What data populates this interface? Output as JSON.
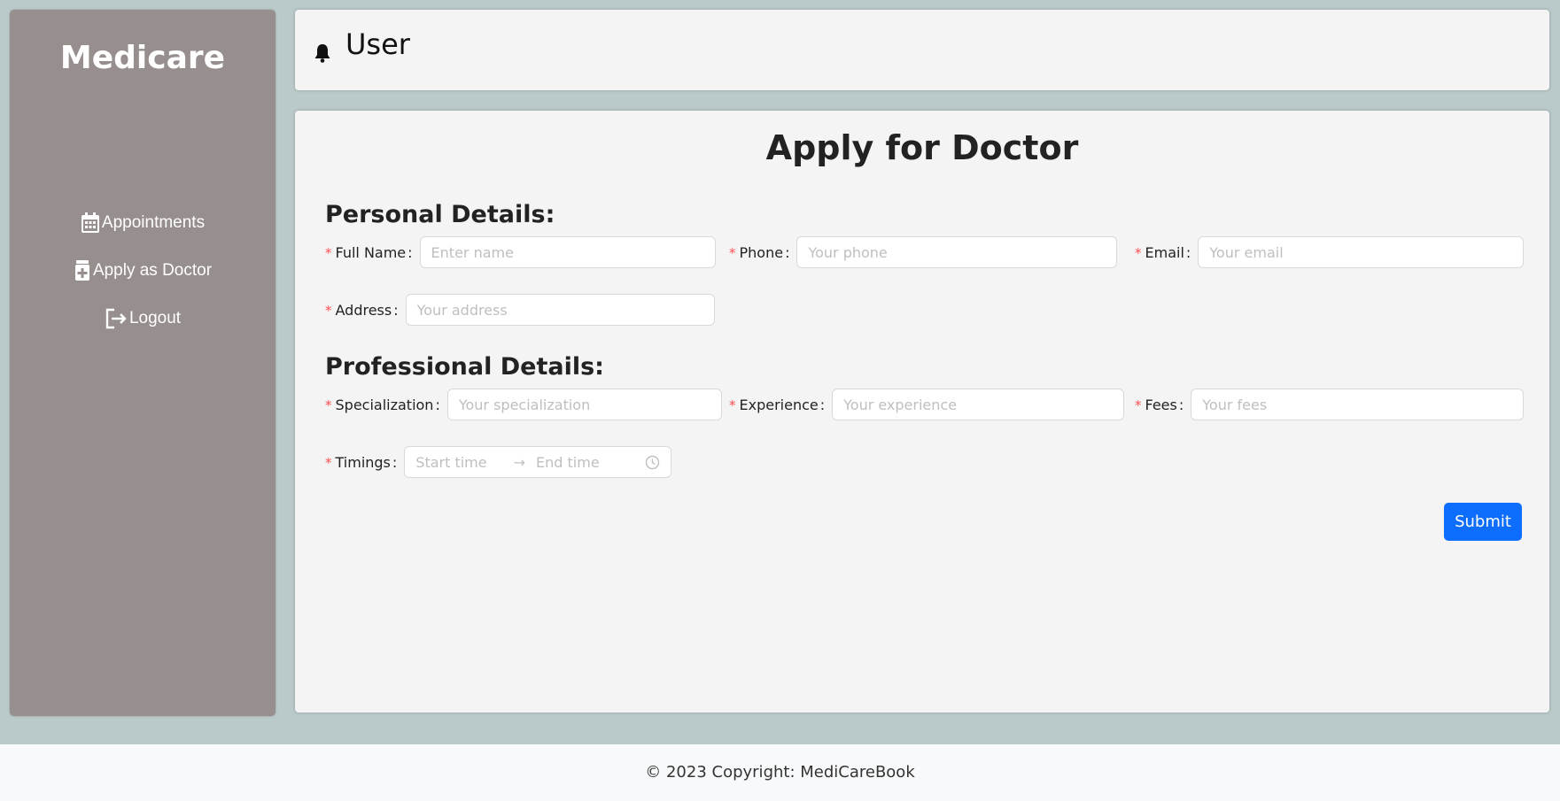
{
  "sidebar": {
    "brand": "Medicare",
    "items": [
      {
        "label": "Appointments",
        "icon": "calendar-icon"
      },
      {
        "label": "Apply as Doctor",
        "icon": "medical-file-icon"
      },
      {
        "label": "Logout",
        "icon": "logout-icon"
      }
    ]
  },
  "header": {
    "user_label": "User",
    "icon": "bell-icon"
  },
  "form": {
    "title": "Apply for Doctor",
    "personal_title": "Personal Details:",
    "professional_title": "Professional Details:",
    "full_name": {
      "label": "Full Name",
      "placeholder": "Enter name",
      "value": ""
    },
    "phone": {
      "label": "Phone",
      "placeholder": "Your phone",
      "value": ""
    },
    "email": {
      "label": "Email",
      "placeholder": "Your email",
      "value": ""
    },
    "address": {
      "label": "Address",
      "placeholder": "Your address",
      "value": ""
    },
    "specialization": {
      "label": "Specialization",
      "placeholder": "Your specialization",
      "value": ""
    },
    "experience": {
      "label": "Experience",
      "placeholder": "Your experience",
      "value": ""
    },
    "fees": {
      "label": "Fees",
      "placeholder": "Your fees",
      "value": ""
    },
    "timings": {
      "label": "Timings",
      "start_placeholder": "Start time",
      "end_placeholder": "End time",
      "arrow": "→"
    },
    "required_mark": "*",
    "colon": ":",
    "submit_label": "Submit"
  },
  "footer": {
    "text": "© 2023 Copyright: MediCareBook"
  },
  "colors": {
    "background": "#bac9c9",
    "sidebar": "#978e8e",
    "panel": "#f4f4f4",
    "primary": "#0d6efd",
    "required": "#ff4d4f"
  }
}
